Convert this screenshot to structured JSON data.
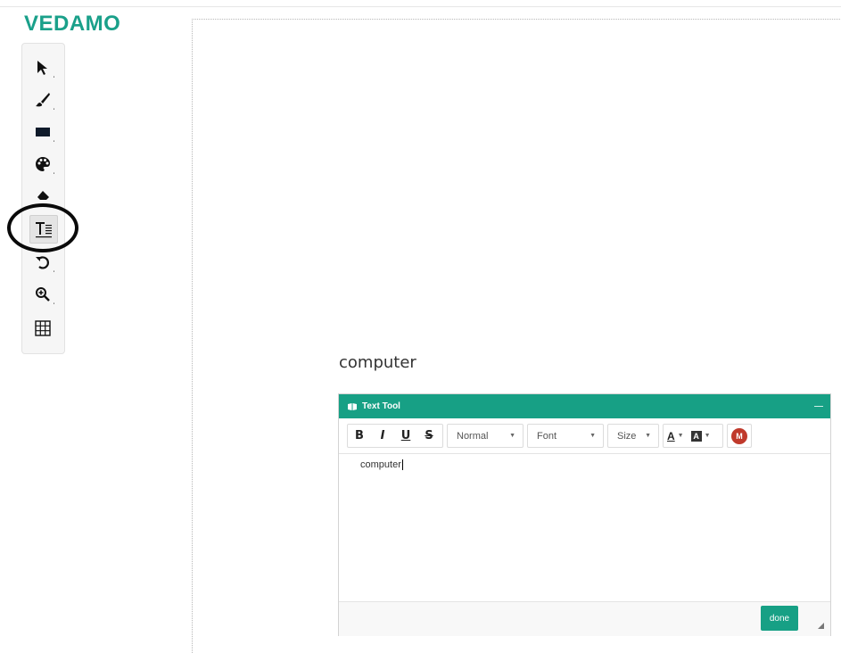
{
  "app": {
    "logo_text": "VEDAMO",
    "brand_color": "#1aa08a"
  },
  "tools": [
    {
      "icon": "pointer-icon",
      "name": "select-tool",
      "submenu": "ˌ"
    },
    {
      "icon": "brush-icon",
      "name": "draw-tool",
      "submenu": "ˌ"
    },
    {
      "icon": "rectangle-icon",
      "name": "shape-tool",
      "submenu": "ˌ"
    },
    {
      "icon": "palette-icon",
      "name": "color-tool",
      "submenu": "ˌ"
    },
    {
      "icon": "eraser-icon",
      "name": "eraser-tool",
      "submenu": ""
    },
    {
      "icon": "text-tool-icon",
      "name": "text-tool",
      "submenu": "",
      "active": true
    },
    {
      "icon": "undo-icon",
      "name": "undo-tool",
      "submenu": "ˌ"
    },
    {
      "icon": "zoom-icon",
      "name": "zoom-tool",
      "submenu": "ˌ"
    },
    {
      "icon": "grid-icon",
      "name": "grid-tool",
      "submenu": ""
    }
  ],
  "canvas": {
    "text": "computer"
  },
  "text_tool": {
    "title": "Text Tool",
    "minimize": "—",
    "format_buttons": {
      "bold": "B",
      "italic": "I",
      "underline": "U",
      "strike": "S"
    },
    "style_select": "Normal",
    "font_select": "Font",
    "size_select": "Size",
    "font_color_label": "A",
    "bg_color_label": "A",
    "math_label": "M",
    "editor_content": "computer",
    "done_label": "done",
    "header_color": "#17a085"
  }
}
